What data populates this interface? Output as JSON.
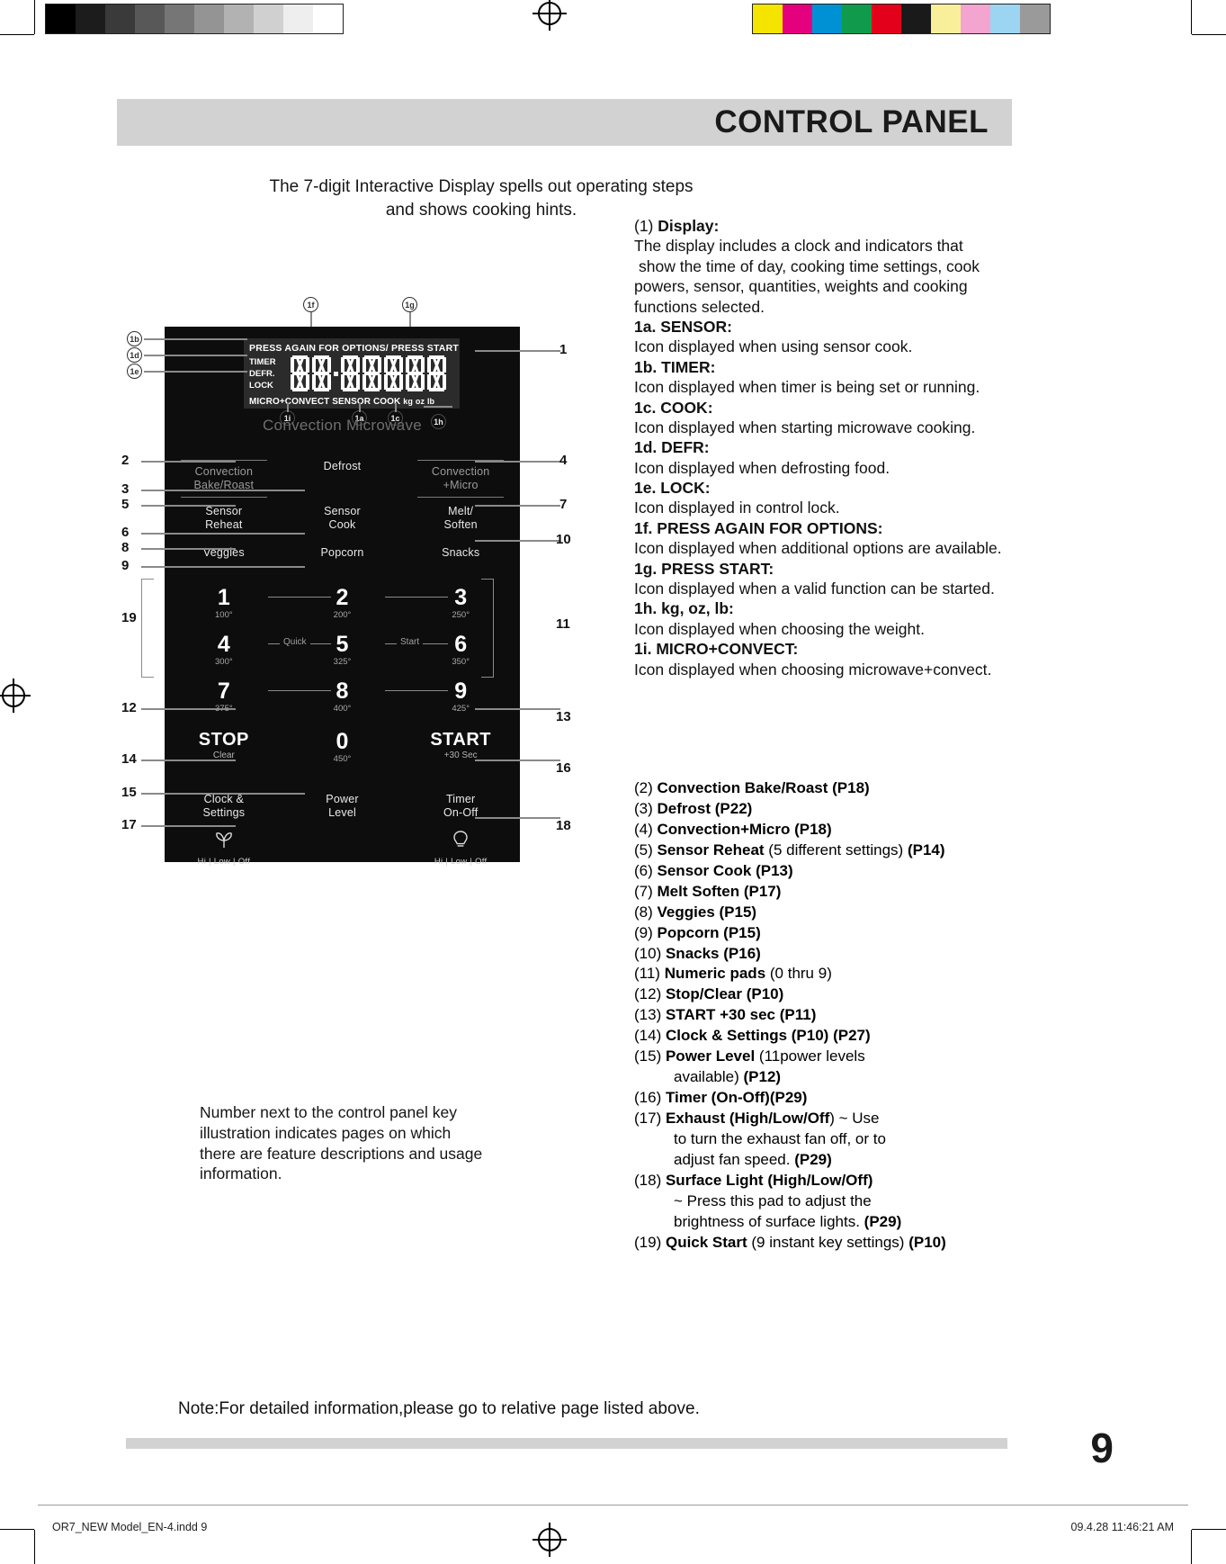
{
  "print_marks": {
    "grayscale_patches": [
      "#000000",
      "#1c1c1c",
      "#3a3a3a",
      "#585858",
      "#767676",
      "#949494",
      "#b2b2b2",
      "#d0d0d0",
      "#eeeeee",
      "#ffffff"
    ],
    "color_patches": [
      "#f5e400",
      "#e5007d",
      "#0091d4",
      "#0f9b4b",
      "#e3001b",
      "#1a1a1a",
      "#f9ef9b",
      "#f3a4cf",
      "#9bd5f2",
      "#9a9a9a"
    ],
    "registration_icon": "registration-target-icon"
  },
  "header": {
    "title": "CONTROL PANEL"
  },
  "intro": {
    "line1": "The 7-digit Interactive Display spells out operating steps",
    "line2": "and shows cooking hints."
  },
  "panel": {
    "brand": "Convection Microwave",
    "lcd": {
      "top_indicator": "PRESS AGAIN FOR OPTIONS/  PRESS START",
      "left_indicators": [
        "TIMER",
        "DEFR.",
        "LOCK"
      ],
      "bottom_indicators": "MICRO+CONVECT  SENSOR  COOK",
      "weight_units": [
        "kg",
        "oz",
        "lb"
      ],
      "digit_count": 7
    },
    "bubbles": {
      "b1f": "1f",
      "b1g": "1g",
      "b1b": "1b",
      "b1d": "1d",
      "b1e": "1e",
      "b1i": "1i",
      "b1a": "1a",
      "b1c": "1c",
      "b1h": "1h"
    },
    "rows": [
      [
        {
          "label": "Convection",
          "sub": "Bake/Roast",
          "style": "dim"
        },
        {
          "label": "Defrost",
          "sub": "",
          "style": "bright"
        },
        {
          "label": "Convection",
          "sub": "+Micro",
          "style": "dim"
        }
      ],
      [
        {
          "label": "Sensor",
          "sub": "Reheat",
          "style": "bright"
        },
        {
          "label": "Sensor",
          "sub": "Cook",
          "style": "bright"
        },
        {
          "label": "Melt/",
          "sub": "Soften",
          "style": "bright"
        }
      ],
      [
        {
          "label": "Veggies",
          "sub": "",
          "style": "bright"
        },
        {
          "label": "Popcorn",
          "sub": "",
          "style": "bright"
        },
        {
          "label": "Snacks",
          "sub": "",
          "style": "bright"
        }
      ]
    ],
    "keypad": [
      [
        {
          "key": "1",
          "temp": "100°"
        },
        {
          "key": "2",
          "temp": "200°"
        },
        {
          "key": "3",
          "temp": "250°"
        }
      ],
      [
        {
          "key": "4",
          "temp": "300°"
        },
        {
          "key": "5",
          "temp": "325°"
        },
        {
          "key": "6",
          "temp": "350°"
        }
      ],
      [
        {
          "key": "7",
          "temp": "375°"
        },
        {
          "key": "8",
          "temp": "400°"
        },
        {
          "key": "9",
          "temp": "425°"
        }
      ]
    ],
    "quick_start": {
      "quick": "Quick",
      "start": "Start"
    },
    "command_row": [
      {
        "main": "STOP",
        "sub": "Clear"
      },
      {
        "main": "0",
        "sub": "450°",
        "numeric": true
      },
      {
        "main": "START",
        "sub": "+30 Sec"
      }
    ],
    "utility_row": [
      {
        "label": "Clock &",
        "sub": "Settings"
      },
      {
        "label": "Power",
        "sub": "Level"
      },
      {
        "label": "Timer",
        "sub": "On-Off"
      }
    ],
    "icon_row": [
      {
        "icon": "exhaust-fan-icon",
        "modes": "Hi | Low | Off"
      },
      {
        "icon": "surface-light-icon",
        "modes": "Hi | Low | Off"
      }
    ],
    "callout_numbers": [
      "1",
      "2",
      "3",
      "4",
      "5",
      "6",
      "7",
      "8",
      "9",
      "10",
      "11",
      "12",
      "13",
      "14",
      "15",
      "16",
      "17",
      "18",
      "19"
    ]
  },
  "descriptions": {
    "d1_index": "(1)",
    "d1_title": "Display:",
    "d1_body": [
      "The display includes a clock and indicators  that",
      "show the time of day, cooking time settings, cook",
      "powers, sensor, quantities, weights and cooking",
      "functions selected."
    ],
    "items": [
      {
        "title": "1a. SENSOR:",
        "body": "Icon displayed when using sensor cook."
      },
      {
        "title": "1b. TIMER:",
        "body": "Icon displayed when timer is being set or running."
      },
      {
        "title": "1c. COOK:",
        "body": "Icon displayed when starting microwave cooking."
      },
      {
        "title": "1d. DEFR:",
        "body": "Icon displayed when defrosting food."
      },
      {
        "title": "1e. LOCK:",
        "body": "Icon displayed in control lock."
      },
      {
        "title": "1f. PRESS AGAIN FOR OPTIONS:",
        "body": "Icon displayed when additional options are available."
      },
      {
        "title": "1g. PRESS START:",
        "body": "Icon displayed when a valid function can be started."
      },
      {
        "title": "1h. kg, oz, lb:",
        "body": "Icon displayed when choosing the weight."
      },
      {
        "title": "1i. MICRO+CONVECT:",
        "body": " Icon displayed when choosing microwave+convect."
      }
    ]
  },
  "numbered_list": [
    {
      "num": "(2)",
      "bold": "Convection Bake/Roast (P18)",
      "rest": ""
    },
    {
      "num": "(3)",
      "bold": "Defrost  (P22)",
      "rest": ""
    },
    {
      "num": "(4)",
      "bold": "Convection+Micro (P18)",
      "rest": ""
    },
    {
      "num": "(5)",
      "bold": "Sensor Reheat",
      "rest": " (5 different settings) ",
      "tail": "(P14)"
    },
    {
      "num": "(6)",
      "bold": "Sensor Cook  (P13)",
      "rest": ""
    },
    {
      "num": "(7)",
      "bold": "Melt Soften  (P17)",
      "rest": ""
    },
    {
      "num": "(8)",
      "bold": "Veggies (P15)",
      "rest": ""
    },
    {
      "num": "(9)",
      "bold": "Popcorn  (P15)",
      "rest": ""
    },
    {
      "num": "(10)",
      "bold": "Snacks  (P16)",
      "rest": ""
    },
    {
      "num": "(11)",
      "bold": "Numeric pads",
      "rest": " (0 thru 9)"
    },
    {
      "num": "(12)",
      "bold": "Stop/Clear  (P10)",
      "rest": ""
    },
    {
      "num": "(13)",
      "bold": "START  +30 sec  (P11)",
      "rest": ""
    },
    {
      "num": "(14)",
      "bold": "Clock & Settings  (P10) (P27)",
      "rest": ""
    },
    {
      "num": "(15)",
      "bold": "Power Level",
      "rest": " (11power levels",
      "cont": "available)",
      "cont_bold": "(P12)"
    },
    {
      "num": "(16)",
      "bold": "Timer (On-Off)(P29)",
      "rest": ""
    },
    {
      "num": "(17)",
      "bold": "Exhaust (High/Low/Off",
      "rest": ") ~ Use",
      "cont_lines": [
        "to turn the exhaust fan off, or to",
        "adjust fan speed. "
      ],
      "cont_bold": "(P29)"
    },
    {
      "num": "(18)",
      "bold": "Surface Light (High/Low/Off)",
      "rest": "",
      "cont_lines": [
        "~ Press this pad to adjust the",
        "brightness of surface lights. "
      ],
      "cont_bold": "(P29)"
    },
    {
      "num": "(19)",
      "bold": "Quick Start",
      "rest": " (9 instant key settings)  ",
      "tail": "(P10)"
    }
  ],
  "note_left": [
    "Number next to the control panel key",
    "illustration indicates pages on which",
    "there are feature descriptions and usage",
    "information."
  ],
  "note_bottom": "Note:For detailed information,please go to relative page listed above.",
  "footer": {
    "page_number": "9",
    "left": "OR7_NEW Model_EN-4.indd   9",
    "right": "09.4.28   11:46:21 AM"
  }
}
